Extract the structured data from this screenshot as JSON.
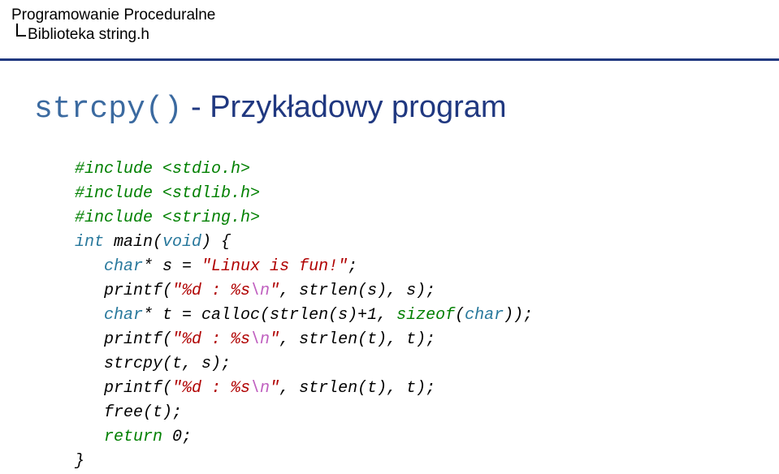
{
  "header": {
    "line1": "Programowanie Proceduralne",
    "line2": "Biblioteka string.h"
  },
  "title": {
    "mono": "strcpy()",
    "rest": " - Przykładowy program"
  },
  "code": {
    "l1": {
      "a": "#include <stdio.h>"
    },
    "l2": {
      "a": "#include <stdlib.h>"
    },
    "l3": {
      "a": "#include <string.h>"
    },
    "l4": {
      "a": "int",
      "b": " main(",
      "c": "void",
      "d": ") {"
    },
    "l5": {
      "a": "   ",
      "b": "char",
      "c": "* s = ",
      "d": "\"Linux is fun!\"",
      "e": ";"
    },
    "l6": {
      "a": "   printf(",
      "b": "\"%d : %s",
      "c": "\\n",
      "d": "\"",
      "e": ", strlen(s), s);"
    },
    "l7": {
      "a": "   ",
      "b": "char",
      "c": "* t = calloc(strlen(s)+1, ",
      "d": "sizeof",
      "e": "(",
      "f": "char",
      "g": "));"
    },
    "l8": {
      "a": "   printf(",
      "b": "\"%d : %s",
      "c": "\\n",
      "d": "\"",
      "e": ", strlen(t), t);"
    },
    "l9": {
      "a": "   strcpy(t, s);"
    },
    "l10": {
      "a": "   printf(",
      "b": "\"%d : %s",
      "c": "\\n",
      "d": "\"",
      "e": ", strlen(t), t);"
    },
    "l11": {
      "a": "   free(t);"
    },
    "l12": {
      "a": "   ",
      "b": "return",
      "c": " 0;"
    },
    "l13": {
      "a": "}"
    }
  }
}
